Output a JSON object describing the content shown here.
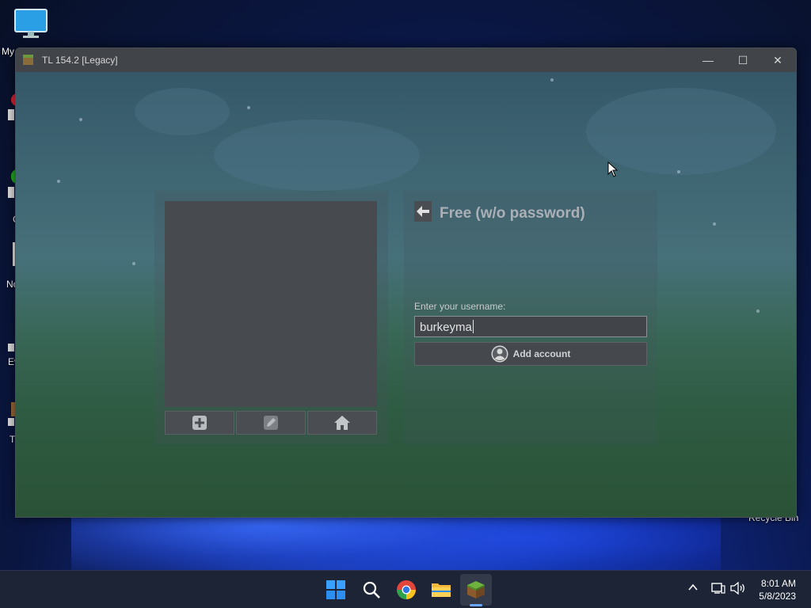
{
  "window": {
    "title": "TL 154.2 [Legacy]",
    "minimize_glyph": "—",
    "maximize_glyph": "☐",
    "close_glyph": "✕"
  },
  "account_panel": {
    "title": "Free (w/o password)",
    "username_label": "Enter your username:",
    "username_value": "burkeyma",
    "add_button_label": "Add account"
  },
  "desktop": {
    "icons": [
      {
        "label": "My",
        "icon": "monitor-icon"
      }
    ],
    "fragments": [
      "C",
      "No",
      "Ev",
      "T"
    ],
    "recycle_bin_label": "Recycle Bin"
  },
  "taskbar": {
    "apps": [
      "start-icon",
      "search-icon",
      "chrome-icon",
      "file-explorer-icon",
      "minecraft-launcher-icon"
    ],
    "time": "8:01 AM",
    "date": "5/8/2023"
  },
  "colors": {
    "window_bg": "#3a3f44",
    "accent": "#6aa6ff"
  }
}
